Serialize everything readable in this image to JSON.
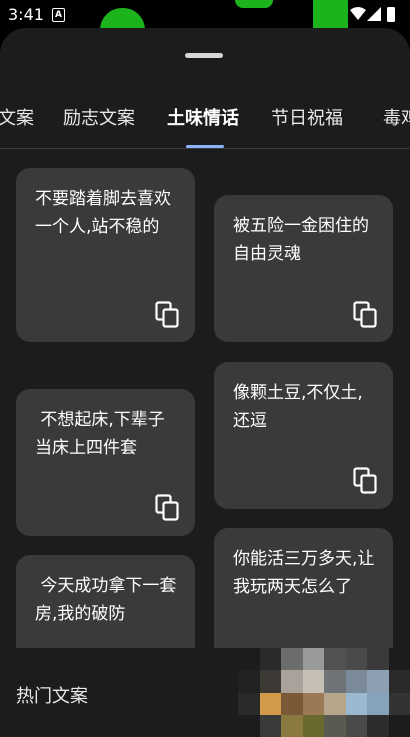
{
  "status_bar": {
    "time": "3:41",
    "notification_icon": "notification-icon",
    "wifi_icon": "wifi-icon",
    "signal_icon": "signal-icon",
    "battery_icon": "battery-icon"
  },
  "sheet": {
    "handle_icon": "drag-handle"
  },
  "tabs": {
    "items": [
      {
        "label": "文案"
      },
      {
        "label": "励志文案"
      },
      {
        "label": "土味情话"
      },
      {
        "label": "节日祝福"
      },
      {
        "label": "毒鸡"
      }
    ],
    "active_index": 2,
    "indicator_color": "#8ab4f8"
  },
  "cards": {
    "left": [
      {
        "text": "不要踏着脚去喜欢一个人,站不稳的"
      },
      {
        "text": " 不想起床,下辈子当床上四件套"
      },
      {
        "text": " 今天成功拿下一套房,我的破防"
      }
    ],
    "right": [
      {
        "text": "被五险一金困住的自由灵魂"
      },
      {
        "text": "像颗土豆,不仅土,还逗"
      },
      {
        "text": "你能活三万多天,让我玩两天怎么了"
      }
    ],
    "copy_icon": "copy-icon",
    "card_color": "#3a3a3c"
  },
  "bottom_bar": {
    "label": "热门文案"
  },
  "colors": {
    "background": "#000000",
    "sheet": "#1c1c1e",
    "accent": "#8ab4f8",
    "status_green": "#1db31d"
  }
}
